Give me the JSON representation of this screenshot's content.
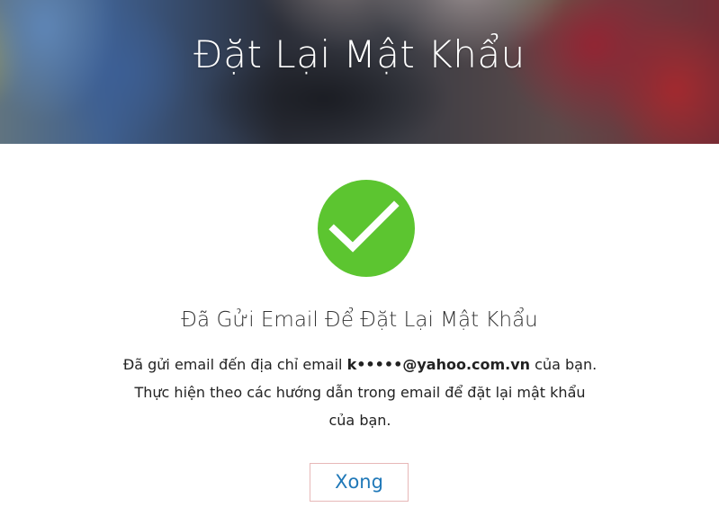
{
  "header": {
    "title": "Đặt Lại Mật Khẩu"
  },
  "status": {
    "icon": "checkmark-icon",
    "color": "#5cc530",
    "title": "Đã Gửi Email Để Đặt Lại Mật Khẩu"
  },
  "message": {
    "line1_prefix": "Đã gửi email đến địa chỉ email ",
    "email": "k•••••@yahoo.com.vn",
    "line1_suffix": " của bạn.",
    "line2": "Thực hiện theo các hướng dẫn trong email để đặt lại mật khẩu",
    "line3": "của bạn."
  },
  "actions": {
    "done_label": "Xong",
    "done_color": "#1f78b8"
  }
}
